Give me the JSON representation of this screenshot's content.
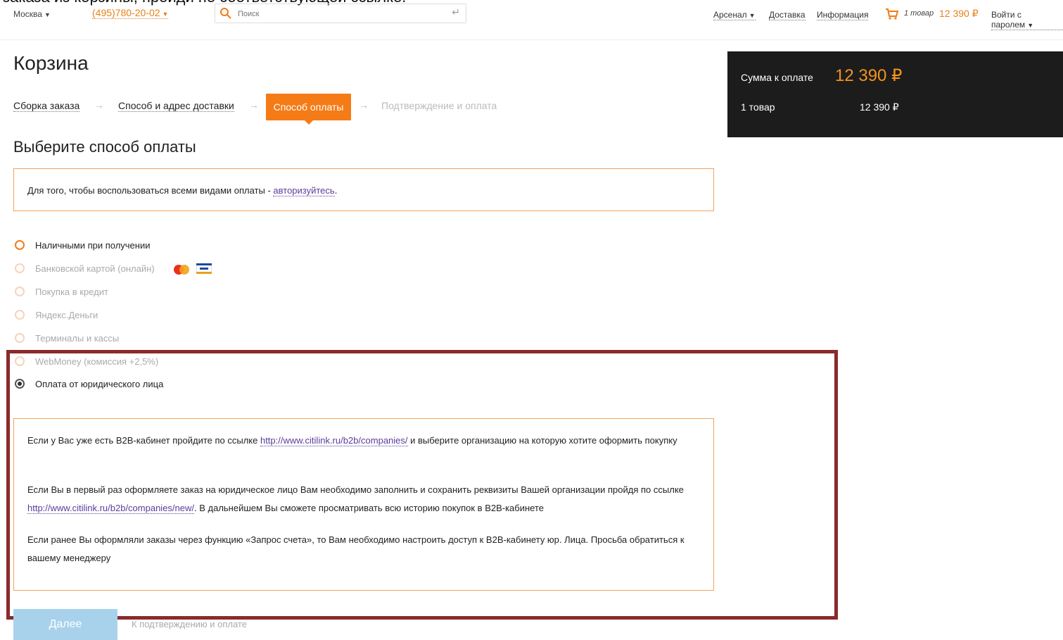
{
  "caption": "заказа из корзины, пройди по соответствующей ссылке.",
  "header": {
    "city": "Москва",
    "phone": "(495)780-20-02",
    "search_placeholder": "Поиск",
    "nav": [
      "Арсенал",
      "Доставка",
      "Информация"
    ],
    "cart_count": "1 товар",
    "cart_sum": "12 390 ₽",
    "login": "Войти с паролем"
  },
  "page": {
    "title": "Корзина",
    "steps": [
      "Сборка заказа",
      "Способ и адрес доставки",
      "Способ оплаты",
      "Подтверждение и оплата"
    ],
    "subtitle": "Выберите способ оплаты",
    "notice_text": "Для того, чтобы воспользоваться всеми видами оплаты - ",
    "notice_link": "авторизуйтесь",
    "notice_end": "."
  },
  "methods": [
    {
      "label": "Наличными при получении",
      "state": "available"
    },
    {
      "label": "Банковской картой (онлайн)",
      "state": "disabled"
    },
    {
      "label": "Покупка в кредит",
      "state": "disabled"
    },
    {
      "label": "Яндекс.Деньги",
      "state": "disabled"
    },
    {
      "label": "Терминалы и кассы",
      "state": "disabled"
    },
    {
      "label": "WebMoney (комиссия +2,5%)",
      "state": "disabled"
    },
    {
      "label": "Оплата от юридического лица",
      "state": "selected"
    }
  ],
  "info": {
    "p1_a": "Если у Вас уже есть B2B-кабинет пройдите по ссылке ",
    "p1_link": "http://www.citilink.ru/b2b/companies/",
    "p1_b": " и выберите организацию на которую хотите оформить покупку",
    "p2_a": "Если Вы в первый раз оформляете заказ на юридическое лицо Вам необходимо заполнить и сохранить реквизиты Вашей организации пройдя по ссылке ",
    "p2_link": "http://www.citilink.ru/b2b/companies/new/",
    "p2_b": ". В дальнейшем Вы сможете просматривать всю историю покупок в B2B-кабинете",
    "p3": "Если ранее Вы оформляли заказы через функцию «Запрос счета», то Вам необходимо настроить доступ к B2B-кабинету юр. Лица. Просьба обратиться к вашему менеджеру"
  },
  "bottom": {
    "next_label": "Далее",
    "next_hint": "К подтверждению и оплате"
  },
  "summary": {
    "label": "Сумма к оплате",
    "total": "12 390 ₽",
    "items_label": "1 товар",
    "items_value": "12 390 ₽"
  },
  "colors": {
    "accent": "#f47b16",
    "summary_bg": "#1c1c1c",
    "highlight": "#8b2a2a"
  }
}
